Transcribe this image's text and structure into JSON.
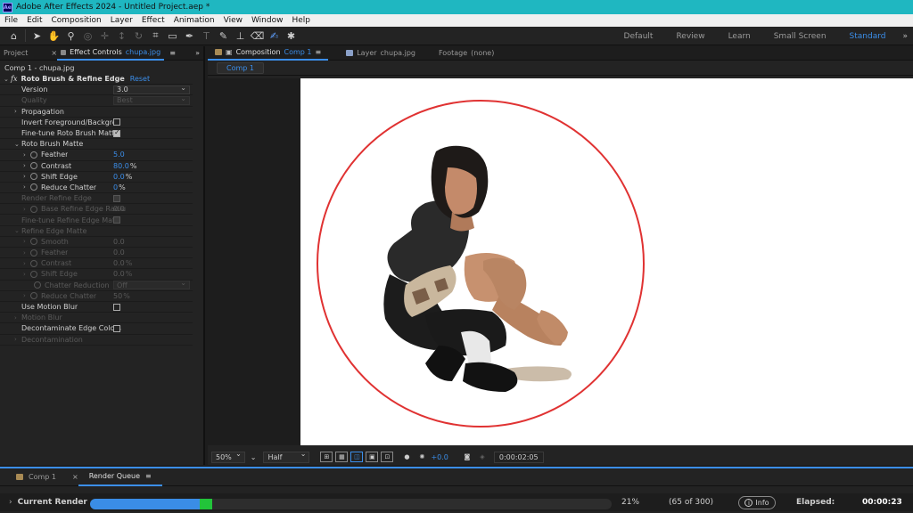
{
  "window": {
    "title": "Adobe After Effects 2024 - Untitled Project.aep *",
    "logo": "Ae"
  },
  "menu": [
    "File",
    "Edit",
    "Composition",
    "Layer",
    "Effect",
    "Animation",
    "View",
    "Window",
    "Help"
  ],
  "workspaces": [
    "Default",
    "Review",
    "Learn",
    "Small Screen",
    "Standard"
  ],
  "workspace_selected": "Standard",
  "left_panel": {
    "tab_project": "Project",
    "tab_effect_controls": "Effect Controls",
    "tab_effect_controls_layer": "chupa.jpg",
    "header": "Comp 1 - chupa.jpg",
    "effect_name": "Roto Brush & Refine Edge",
    "reset": "Reset",
    "rows": {
      "version": {
        "name": "Version",
        "value": "3.0"
      },
      "quality": {
        "name": "Quality",
        "value": "Best"
      },
      "propagation": "Propagation",
      "invert": "Invert Foreground/Backgro",
      "finetune": "Fine-tune Roto Brush Matte",
      "roto_matte": "Roto Brush Matte",
      "feather": {
        "name": "Feather",
        "value": "5.0"
      },
      "contrast": {
        "name": "Contrast",
        "value": "80.0",
        "unit": "%"
      },
      "shift_edge": {
        "name": "Shift Edge",
        "value": "0.0",
        "unit": "%"
      },
      "reduce_chatter": {
        "name": "Reduce Chatter",
        "value": "0",
        "unit": "%"
      },
      "render_refine": "Render Refine Edge",
      "base_refine": {
        "name": "Base Refine Edge Radiu",
        "value": "0.0"
      },
      "finetune_refine": "Fine-tune Refine Edge Matt",
      "refine_matte": "Refine Edge Matte",
      "smooth": {
        "name": "Smooth",
        "value": "0.0"
      },
      "feather2": {
        "name": "Feather",
        "value": "0.0"
      },
      "contrast2": {
        "name": "Contrast",
        "value": "0.0",
        "unit": "%"
      },
      "shift_edge2": {
        "name": "Shift Edge",
        "value": "0.0",
        "unit": "%"
      },
      "chatter_reduction": {
        "name": "Chatter Reduction",
        "value": "Off"
      },
      "reduce_chatter2": {
        "name": "Reduce Chatter",
        "value": "50",
        "unit": "%"
      },
      "use_motion_blur": "Use Motion Blur",
      "motion_blur": "Motion Blur",
      "decontaminate": "Decontaminate Edge Colors",
      "decontamination": "Decontamination"
    }
  },
  "composition": {
    "tab_label": "Composition",
    "tab_comp": "Comp 1",
    "layer_label": "Layer",
    "layer_name": "chupa.jpg",
    "footage_label": "Footage",
    "footage_value": "(none)",
    "subtab": "Comp 1",
    "zoom": "50%",
    "resolution": "Half",
    "exposure": "+0.0",
    "timecode": "0:00:02:05"
  },
  "bottom": {
    "tab_comp": "Comp 1",
    "tab_render_queue": "Render Queue",
    "current_render_label": "Current Render",
    "progress_fraction": 0.21,
    "percent": "21%",
    "frames": "(65 of 300)",
    "info": "Info",
    "elapsed_label": "Elapsed:",
    "elapsed_value": "00:00:23"
  },
  "colors": {
    "accent": "#3b8eea",
    "title_bar": "#1fb7c1",
    "circle": "#e03232",
    "progress": "#3a8de6",
    "progress_tip": "#22c43a"
  }
}
